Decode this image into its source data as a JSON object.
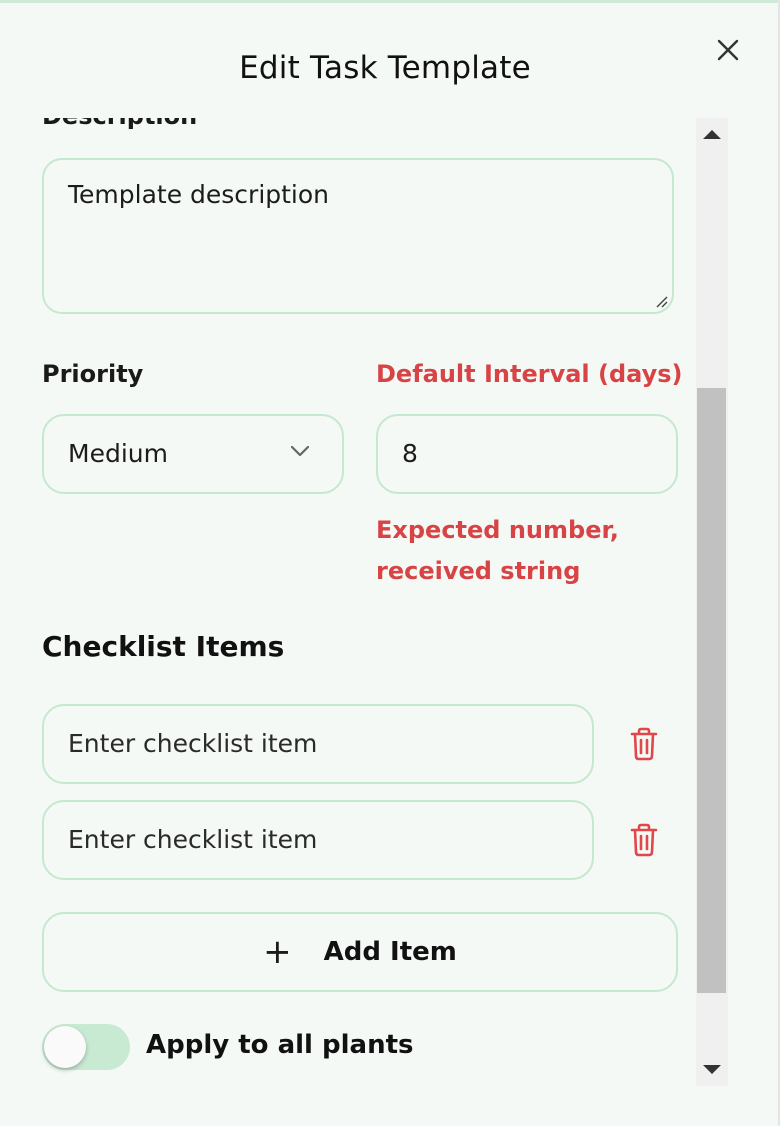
{
  "modal": {
    "title": "Edit Task Template",
    "close_label": "×"
  },
  "form": {
    "description_label": "Description",
    "description_value": "Template description",
    "priority_label": "Priority",
    "priority_value": "Medium",
    "interval_label": "Default Interval (days)",
    "interval_value": "8",
    "interval_error": "Expected number, received string",
    "checklist_title": "Checklist Items",
    "checklist_items": [
      {
        "placeholder": "Enter checklist item",
        "value": ""
      },
      {
        "placeholder": "Enter checklist item",
        "value": ""
      }
    ],
    "add_item_label": "Add Item",
    "add_item_icon": "+",
    "apply_all_label": "Apply to all plants",
    "apply_all_enabled": false
  },
  "colors": {
    "accent_border": "#c6e8cf",
    "error": "#d84446",
    "background": "#f4f9f5",
    "toggle_track": "#c8e9d2"
  },
  "icons": {
    "close": "close-icon",
    "chevron": "chevron-down-icon",
    "trash": "trash-icon",
    "plus": "plus-icon"
  }
}
